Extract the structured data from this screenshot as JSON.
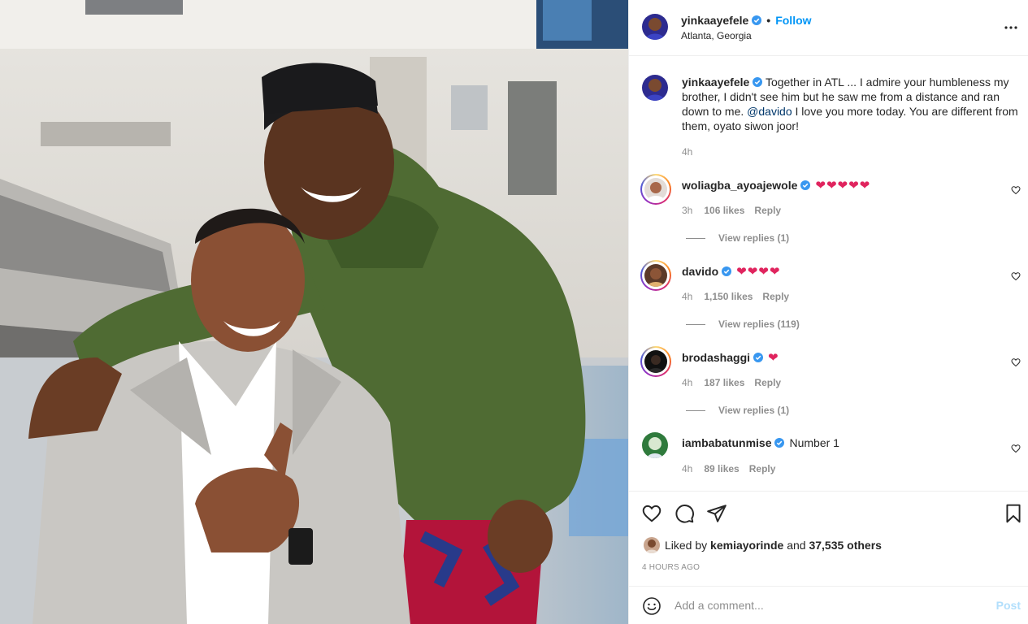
{
  "photo": {
    "alt_subject": "two men smiling at an airport"
  },
  "header": {
    "username": "yinkaayefele",
    "separator": "•",
    "follow_label": "Follow",
    "location": "Atlanta, Georgia",
    "more_icon": "more-horizontal-icon"
  },
  "caption": {
    "username": "yinkaayefele",
    "text_before_mention": "Together in ATL ... I admire your humbleness my brother, I didn't see him but he saw me from a distance and ran down to me. ",
    "mention": "@davido",
    "text_after_mention": " I love you more today. You are different from them, oyato siwon joor!",
    "time": "4h"
  },
  "comments": [
    {
      "username": "woliagba_ayoajewole",
      "text": "❤❤❤❤❤",
      "time": "3h",
      "likes": "106 likes",
      "reply": "Reply",
      "view_replies": "View replies (1)"
    },
    {
      "username": "davido",
      "text": "❤❤❤❤",
      "time": "4h",
      "likes": "1,150 likes",
      "reply": "Reply",
      "view_replies": "View replies (119)"
    },
    {
      "username": "brodashaggi",
      "text": "❤",
      "time": "4h",
      "likes": "187 likes",
      "reply": "Reply",
      "view_replies": "View replies (1)"
    },
    {
      "username": "iambabatunmise",
      "text": "Number 1",
      "time": "4h",
      "likes": "89 likes",
      "reply": "Reply"
    }
  ],
  "actions": {
    "like_icon": "heart-icon",
    "comment_icon": "comment-icon",
    "share_icon": "share-icon",
    "save_icon": "bookmark-icon"
  },
  "likes": {
    "prefix": "Liked by",
    "user": "kemiayorinde",
    "and": "and",
    "others": "37,535 others"
  },
  "timestamp": "4 HOURS AGO",
  "add_comment": {
    "placeholder": "Add a comment...",
    "post_label": "Post"
  },
  "colors": {
    "accent": "#0095f6",
    "post_disabled": "#b2dffc",
    "text": "#262626",
    "muted": "#8e8e8e",
    "heart": "#ed4956"
  }
}
